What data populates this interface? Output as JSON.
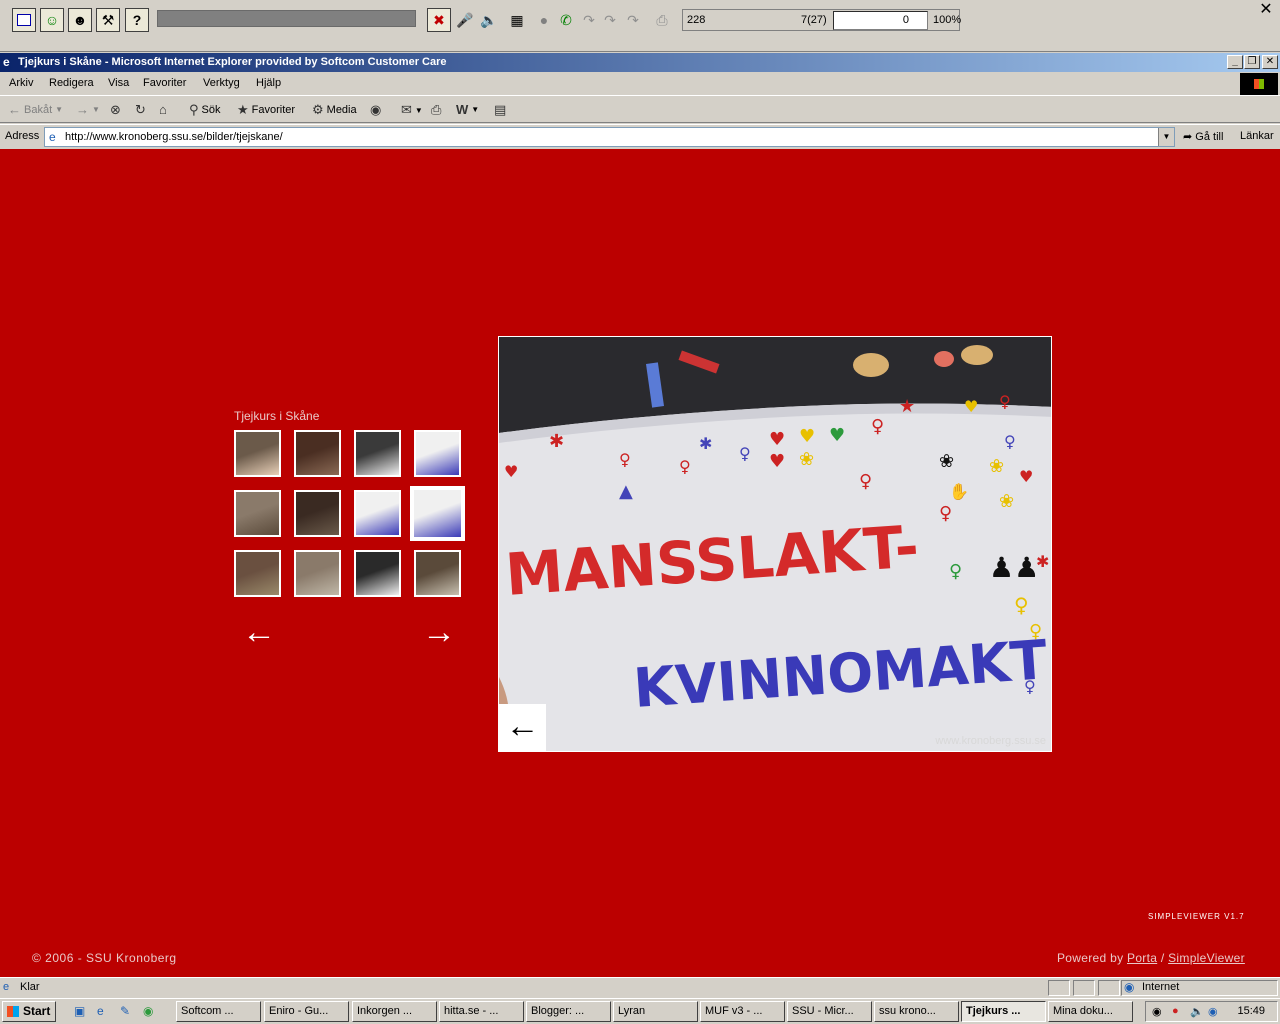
{
  "dialer": {
    "status_left": "228",
    "status_mid": "7(27)",
    "field_value": "0",
    "percent": "100%",
    "close": "✕"
  },
  "window": {
    "title": "Tjejkurs i Skåne - Microsoft Internet Explorer provided by Softcom Customer Care"
  },
  "menu": [
    "Arkiv",
    "Redigera",
    "Visa",
    "Favoriter",
    "Verktyg",
    "Hjälp"
  ],
  "toolbar": {
    "back": "Bakåt",
    "search": "Sök",
    "favorites": "Favoriter",
    "media": "Media"
  },
  "address": {
    "label": "Adress",
    "url": "http://www.kronoberg.ssu.se/bilder/tjejskane/",
    "go": "Gå till",
    "links": "Länkar"
  },
  "gallery": {
    "title": "Tjejkurs i Skåne",
    "selected_index": 7,
    "thumbnail_count": 12,
    "watermark": "www.kronoberg.ssu.se",
    "version": "SIMPLEVIEWER V1.7",
    "copyright": "© 2006 - SSU Kronoberg",
    "powered_prefix": "Powered by",
    "powered_link1": "Porta",
    "powered_sep": "/",
    "powered_link2": "SimpleViewer",
    "banner_line1": "MANSSLAKT-",
    "banner_line2": "KVINNOMAKT"
  },
  "status": {
    "text": "Klar",
    "zone": "Internet"
  },
  "taskbar": {
    "start": "Start",
    "tasks": [
      "Softcom ...",
      "Eniro - Gu...",
      "Inkorgen ...",
      "hitta.se - ...",
      "Blogger: ...",
      "Lyran",
      "MUF v3 - ...",
      "SSU - Micr...",
      "ssu krono...",
      "Tjejkurs ...",
      "Mina doku..."
    ],
    "active_task": 9,
    "clock": "15:49"
  },
  "colors": {
    "page_bg": "#bb0000",
    "title_start": "#0a246a",
    "title_end": "#a6caf0"
  }
}
